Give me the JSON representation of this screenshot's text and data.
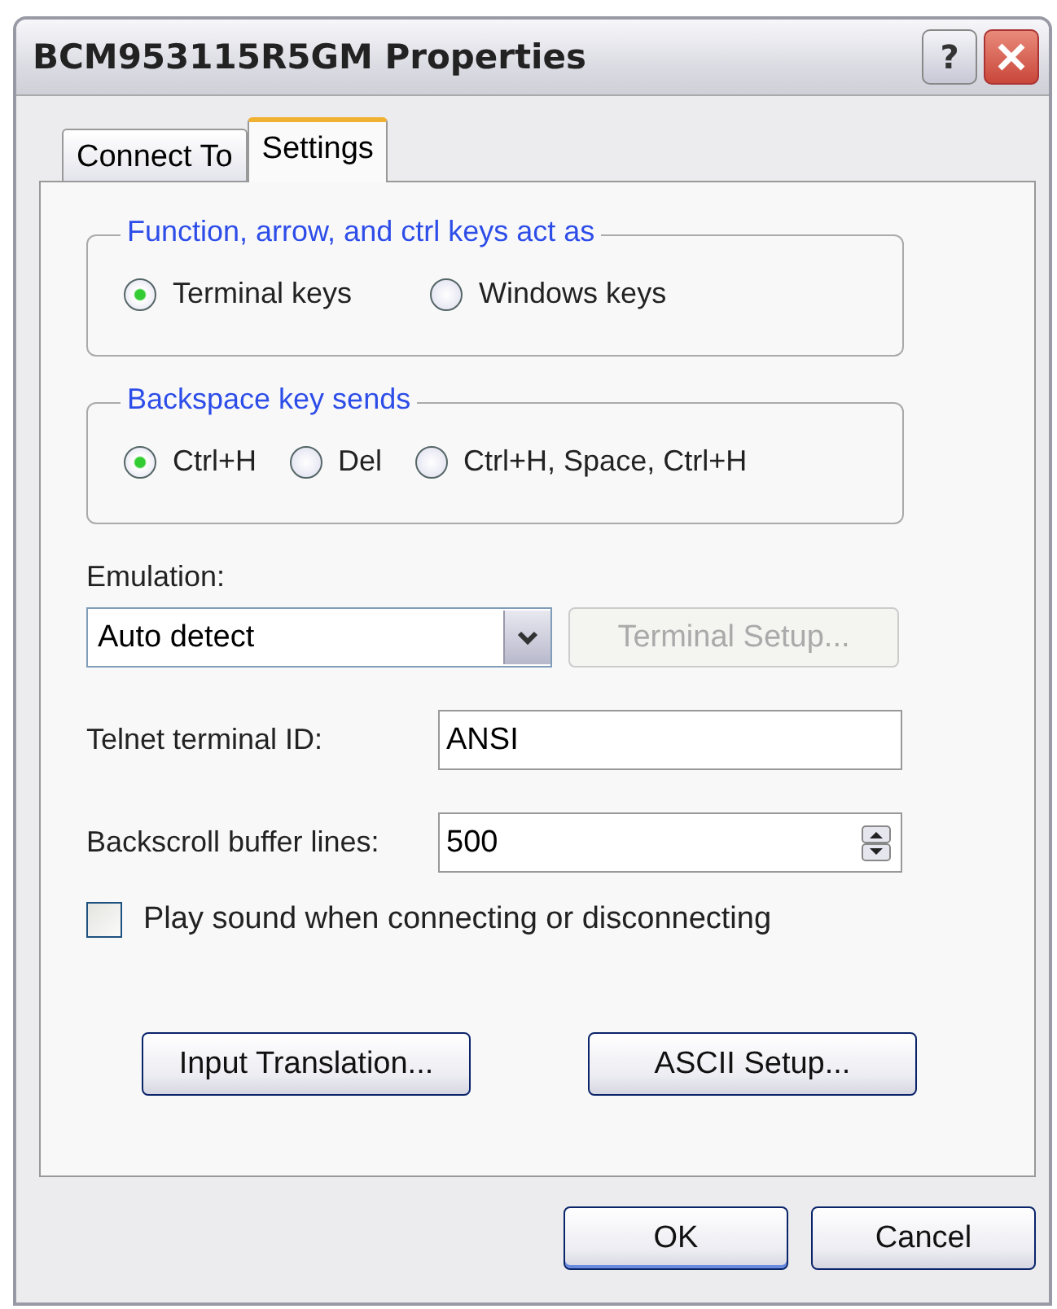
{
  "window": {
    "title": "BCM953115R5GM Properties",
    "help_button": "?"
  },
  "tabs": [
    {
      "label": "Connect To",
      "selected": false
    },
    {
      "label": "Settings",
      "selected": true
    }
  ],
  "groups": [
    {
      "title": "Function, arrow, and ctrl keys act as",
      "options": [
        {
          "label": "Terminal keys",
          "selected": true
        },
        {
          "label": "Windows keys",
          "selected": false
        }
      ]
    },
    {
      "title": "Backspace key sends",
      "options": [
        {
          "label": "Ctrl+H",
          "selected": true
        },
        {
          "label": "Del",
          "selected": false
        },
        {
          "label": "Ctrl+H, Space, Ctrl+H",
          "selected": false
        }
      ]
    }
  ],
  "emulation": {
    "label": "Emulation:",
    "value": "Auto detect"
  },
  "terminal_setup_button": {
    "label": "Terminal Setup...",
    "disabled": true
  },
  "telnet_id": {
    "label": "Telnet terminal ID:",
    "value": "ANSI"
  },
  "backscroll": {
    "label": "Backscroll buffer lines:",
    "value": "500"
  },
  "play_sound": {
    "label": "Play sound when connecting or disconnecting",
    "checked": false
  },
  "panel_buttons": [
    "Input Translation...",
    "ASCII Setup..."
  ],
  "dialog_buttons": [
    "OK",
    "Cancel"
  ]
}
